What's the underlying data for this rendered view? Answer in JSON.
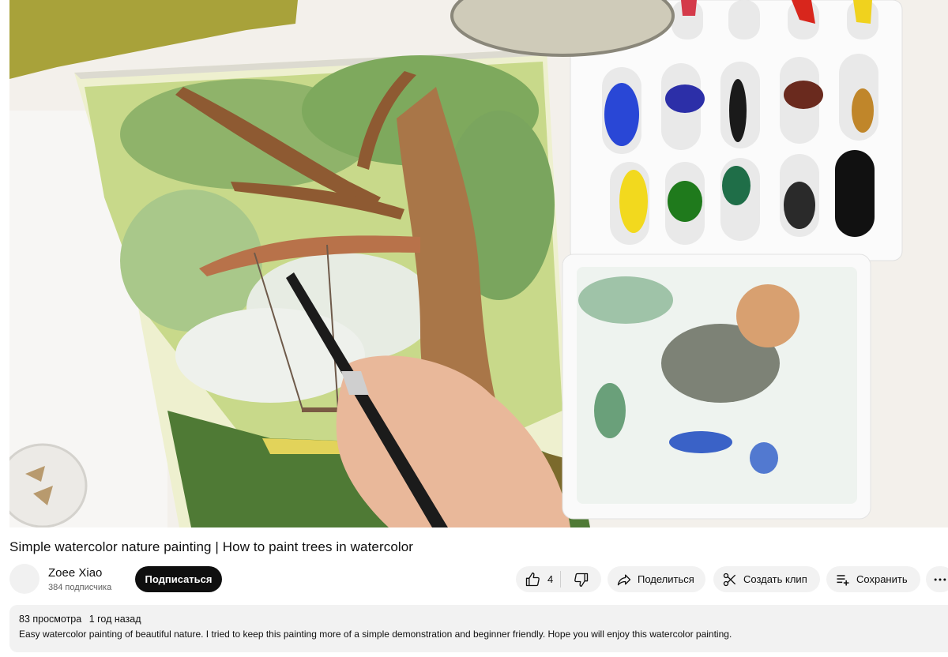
{
  "video": {
    "description": ""
  },
  "title": "Simple watercolor nature painting | How to paint trees in watercolor",
  "channel": {
    "name": "Zoee Xiao",
    "subscribers": "384 подписчика",
    "subscribe_label": "Подписаться"
  },
  "actions": {
    "like_count": "4",
    "share_label": "Поделиться",
    "clip_label": "Создать клип",
    "save_label": "Сохранить"
  },
  "description": {
    "views": "83 просмотра",
    "date": "1 год назад",
    "text": "Easy watercolor painting of beautiful nature. I tried to keep this painting more of a simple demonstration and beginner friendly. Hope you will enjoy this watercolor painting."
  }
}
